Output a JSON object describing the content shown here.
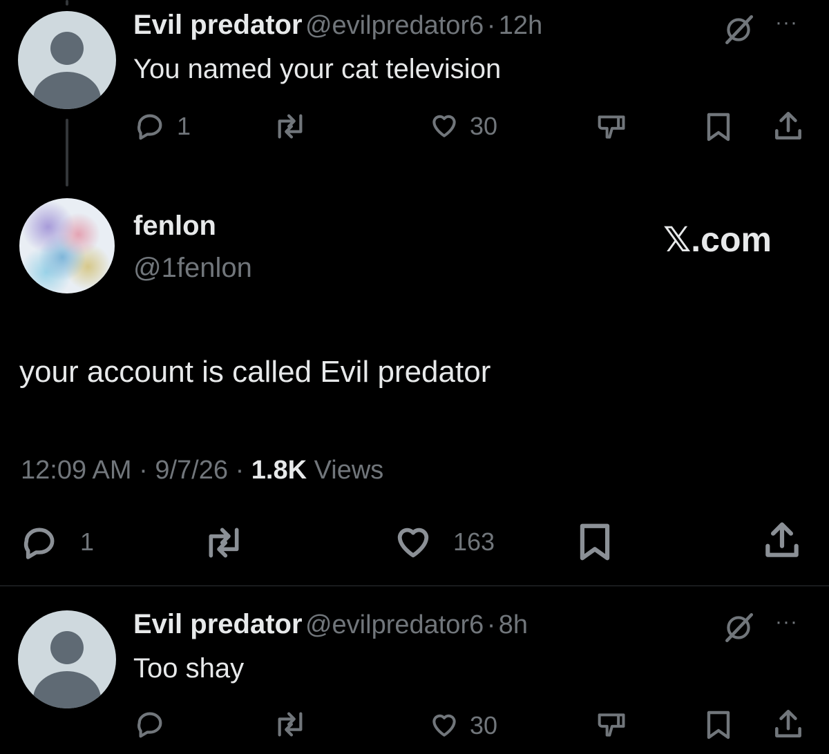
{
  "reply1": {
    "display_name": "Evil predator",
    "handle": "@evilpredator6",
    "separator": "·",
    "time": "12h",
    "text": "You named your cat television",
    "reply_count": "1",
    "like_count": "30",
    "more_label": "···"
  },
  "main": {
    "display_name": "fenlon",
    "handle": "@1fenlon",
    "watermark": "𝕏.com",
    "text": "your account is called Evil predator",
    "time": "12:09 AM",
    "sep": "·",
    "date": "9/7/26",
    "views_count": "1.8K",
    "views_label": "Views",
    "reply_count": "1",
    "like_count": "163"
  },
  "reply2": {
    "display_name": "Evil predator",
    "handle": "@evilpredator6",
    "separator": "·",
    "time": "8h",
    "text": "Too shay",
    "like_count": "30",
    "more_label": "···"
  },
  "icons": [
    "reply-icon",
    "retweet-icon",
    "like-icon",
    "dislike-icon",
    "bookmark-icon",
    "share-icon",
    "grok-icon",
    "more-icon"
  ],
  "colors": {
    "background": "#000000",
    "text": "#e7e9ea",
    "muted": "#71767b",
    "avatar_bg": "#cfd9de"
  }
}
